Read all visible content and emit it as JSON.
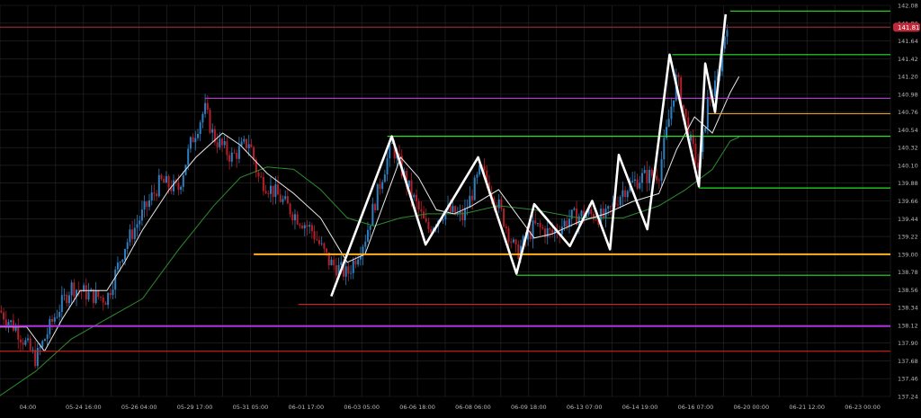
{
  "chart_data": {
    "type": "candlestick",
    "x_ticks": [
      "04:00",
      "05-24 16:00",
      "05-26 04:00",
      "05-29 17:00",
      "05-31 05:00",
      "06-01 17:00",
      "06-03 05:00",
      "06-06 18:00",
      "06-08 06:00",
      "06-09 18:00",
      "06-13 07:00",
      "06-14 19:00",
      "06-16 07:00",
      "06-20 00:00",
      "06-21 12:00",
      "06-23 00:00"
    ],
    "y_ticks": [
      137.24,
      137.46,
      137.68,
      137.9,
      138.12,
      138.34,
      138.56,
      138.78,
      139.0,
      139.22,
      139.44,
      139.66,
      139.88,
      140.1,
      140.32,
      140.54,
      140.76,
      140.98,
      141.2,
      141.42,
      141.64,
      141.86,
      142.08
    ],
    "ylim": [
      137.24,
      142.08
    ],
    "grid": true,
    "current_price": "141.81",
    "colors": {
      "background": "#000000",
      "grid": "#2a2a2a",
      "up_candle": "#2f7fbf",
      "down_candle": "#b3202a",
      "ma_fast": "#e8e8e8",
      "ma_slow": "#2e8b2e",
      "zigzag": "#ffffff",
      "current_price_badge": "#c0283a",
      "current_price_line": "#8a2a3a"
    },
    "horizontal_levels": [
      {
        "price": 142.01,
        "color": "#22e322",
        "from": 0.82
      },
      {
        "price": 141.81,
        "color": "#8a2a3a",
        "from": 0.0
      },
      {
        "price": 141.47,
        "color": "#22e322",
        "from": 0.755
      },
      {
        "price": 140.93,
        "color": "#a040c0",
        "from": 0.23
      },
      {
        "price": 140.74,
        "color": "#e0a020",
        "from": 0.795
      },
      {
        "price": 140.46,
        "color": "#22e322",
        "from": 0.435
      },
      {
        "price": 139.82,
        "color": "#22e322",
        "from": 0.785
      },
      {
        "price": 139.0,
        "color": "#ffb020",
        "from": 0.285
      },
      {
        "price": 138.74,
        "color": "#22e322",
        "from": 0.58
      },
      {
        "price": 138.38,
        "color": "#d02020",
        "from": 0.335
      },
      {
        "price": 138.11,
        "color": "#b030e0",
        "from": 0.0
      },
      {
        "price": 137.8,
        "color": "#d02020",
        "from": 0.0
      }
    ],
    "zigzag": [
      {
        "t": 0.372,
        "p": 138.48
      },
      {
        "t": 0.44,
        "p": 140.46
      },
      {
        "t": 0.478,
        "p": 139.12
      },
      {
        "t": 0.537,
        "p": 140.2
      },
      {
        "t": 0.58,
        "p": 138.76
      },
      {
        "t": 0.6,
        "p": 139.62
      },
      {
        "t": 0.64,
        "p": 139.1
      },
      {
        "t": 0.665,
        "p": 139.66
      },
      {
        "t": 0.685,
        "p": 139.06
      },
      {
        "t": 0.695,
        "p": 140.23
      },
      {
        "t": 0.727,
        "p": 139.31
      },
      {
        "t": 0.752,
        "p": 141.47
      },
      {
        "t": 0.785,
        "p": 139.84
      },
      {
        "t": 0.792,
        "p": 141.36
      },
      {
        "t": 0.803,
        "p": 140.76
      },
      {
        "t": 0.815,
        "p": 141.97
      }
    ],
    "close_path": [
      {
        "t": 0.0,
        "p": 138.3
      },
      {
        "t": 0.02,
        "p": 138.05
      },
      {
        "t": 0.04,
        "p": 137.7
      },
      {
        "t": 0.06,
        "p": 138.2
      },
      {
        "t": 0.08,
        "p": 138.6
      },
      {
        "t": 0.1,
        "p": 138.5
      },
      {
        "t": 0.12,
        "p": 138.45
      },
      {
        "t": 0.14,
        "p": 139.1
      },
      {
        "t": 0.16,
        "p": 139.5
      },
      {
        "t": 0.18,
        "p": 139.9
      },
      {
        "t": 0.2,
        "p": 139.8
      },
      {
        "t": 0.215,
        "p": 140.4
      },
      {
        "t": 0.23,
        "p": 140.8
      },
      {
        "t": 0.24,
        "p": 140.45
      },
      {
        "t": 0.26,
        "p": 140.2
      },
      {
        "t": 0.28,
        "p": 140.4
      },
      {
        "t": 0.29,
        "p": 139.95
      },
      {
        "t": 0.31,
        "p": 139.75
      },
      {
        "t": 0.33,
        "p": 139.5
      },
      {
        "t": 0.35,
        "p": 139.3
      },
      {
        "t": 0.37,
        "p": 138.9
      },
      {
        "t": 0.39,
        "p": 138.75
      },
      {
        "t": 0.41,
        "p": 139.2
      },
      {
        "t": 0.43,
        "p": 140.0
      },
      {
        "t": 0.44,
        "p": 140.35
      },
      {
        "t": 0.46,
        "p": 139.8
      },
      {
        "t": 0.48,
        "p": 139.3
      },
      {
        "t": 0.5,
        "p": 139.55
      },
      {
        "t": 0.52,
        "p": 139.45
      },
      {
        "t": 0.54,
        "p": 140.05
      },
      {
        "t": 0.56,
        "p": 139.6
      },
      {
        "t": 0.58,
        "p": 139.0
      },
      {
        "t": 0.6,
        "p": 139.35
      },
      {
        "t": 0.62,
        "p": 139.25
      },
      {
        "t": 0.64,
        "p": 139.45
      },
      {
        "t": 0.66,
        "p": 139.5
      },
      {
        "t": 0.68,
        "p": 139.45
      },
      {
        "t": 0.7,
        "p": 139.8
      },
      {
        "t": 0.72,
        "p": 139.95
      },
      {
        "t": 0.74,
        "p": 140.0
      },
      {
        "t": 0.75,
        "p": 140.6
      },
      {
        "t": 0.76,
        "p": 141.2
      },
      {
        "t": 0.775,
        "p": 140.4
      },
      {
        "t": 0.785,
        "p": 140.05
      },
      {
        "t": 0.795,
        "p": 140.9
      },
      {
        "t": 0.805,
        "p": 141.1
      },
      {
        "t": 0.815,
        "p": 141.8
      },
      {
        "t": 0.818,
        "p": 141.95
      }
    ],
    "ma_fast": [
      {
        "t": 0.0,
        "p": 138.1
      },
      {
        "t": 0.03,
        "p": 138.1
      },
      {
        "t": 0.05,
        "p": 137.8
      },
      {
        "t": 0.07,
        "p": 138.2
      },
      {
        "t": 0.09,
        "p": 138.55
      },
      {
        "t": 0.12,
        "p": 138.55
      },
      {
        "t": 0.14,
        "p": 138.9
      },
      {
        "t": 0.16,
        "p": 139.3
      },
      {
        "t": 0.19,
        "p": 139.8
      },
      {
        "t": 0.22,
        "p": 140.2
      },
      {
        "t": 0.25,
        "p": 140.5
      },
      {
        "t": 0.27,
        "p": 140.35
      },
      {
        "t": 0.3,
        "p": 140.0
      },
      {
        "t": 0.33,
        "p": 139.75
      },
      {
        "t": 0.36,
        "p": 139.45
      },
      {
        "t": 0.39,
        "p": 138.9
      },
      {
        "t": 0.41,
        "p": 139.0
      },
      {
        "t": 0.43,
        "p": 139.6
      },
      {
        "t": 0.45,
        "p": 140.2
      },
      {
        "t": 0.47,
        "p": 139.95
      },
      {
        "t": 0.49,
        "p": 139.55
      },
      {
        "t": 0.51,
        "p": 139.5
      },
      {
        "t": 0.53,
        "p": 139.6
      },
      {
        "t": 0.56,
        "p": 139.8
      },
      {
        "t": 0.58,
        "p": 139.5
      },
      {
        "t": 0.6,
        "p": 139.2
      },
      {
        "t": 0.62,
        "p": 139.25
      },
      {
        "t": 0.65,
        "p": 139.4
      },
      {
        "t": 0.68,
        "p": 139.5
      },
      {
        "t": 0.71,
        "p": 139.65
      },
      {
        "t": 0.74,
        "p": 139.75
      },
      {
        "t": 0.76,
        "p": 140.3
      },
      {
        "t": 0.78,
        "p": 140.7
      },
      {
        "t": 0.8,
        "p": 140.5
      },
      {
        "t": 0.82,
        "p": 141.0
      },
      {
        "t": 0.83,
        "p": 141.2
      }
    ],
    "ma_slow": [
      {
        "t": 0.0,
        "p": 137.25
      },
      {
        "t": 0.04,
        "p": 137.55
      },
      {
        "t": 0.08,
        "p": 137.95
      },
      {
        "t": 0.12,
        "p": 138.2
      },
      {
        "t": 0.16,
        "p": 138.45
      },
      {
        "t": 0.2,
        "p": 139.05
      },
      {
        "t": 0.24,
        "p": 139.6
      },
      {
        "t": 0.27,
        "p": 139.95
      },
      {
        "t": 0.3,
        "p": 140.08
      },
      {
        "t": 0.33,
        "p": 140.05
      },
      {
        "t": 0.36,
        "p": 139.8
      },
      {
        "t": 0.39,
        "p": 139.45
      },
      {
        "t": 0.42,
        "p": 139.35
      },
      {
        "t": 0.45,
        "p": 139.45
      },
      {
        "t": 0.48,
        "p": 139.5
      },
      {
        "t": 0.52,
        "p": 139.5
      },
      {
        "t": 0.56,
        "p": 139.6
      },
      {
        "t": 0.6,
        "p": 139.55
      },
      {
        "t": 0.65,
        "p": 139.45
      },
      {
        "t": 0.7,
        "p": 139.45
      },
      {
        "t": 0.74,
        "p": 139.6
      },
      {
        "t": 0.77,
        "p": 139.8
      },
      {
        "t": 0.8,
        "p": 140.05
      },
      {
        "t": 0.82,
        "p": 140.4
      },
      {
        "t": 0.83,
        "p": 140.45
      }
    ]
  }
}
